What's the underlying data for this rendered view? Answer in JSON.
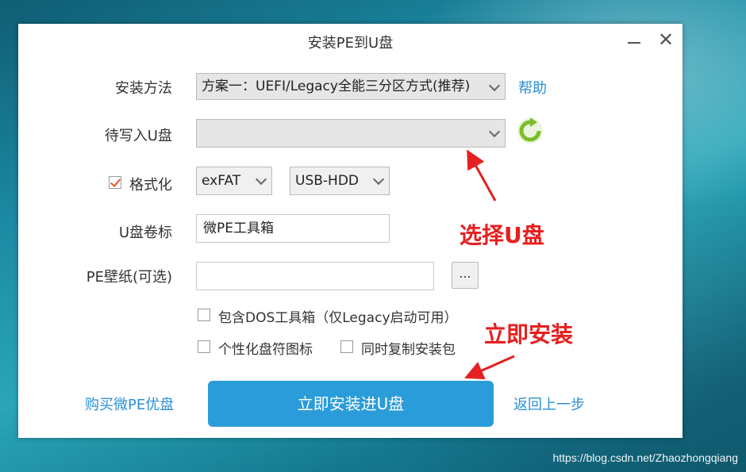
{
  "window": {
    "title": "安装PE到U盘"
  },
  "form": {
    "method_label": "安装方法",
    "method_value": "方案一：UEFI/Legacy全能三分区方式(推荐)",
    "help_link": "帮助",
    "target_label": "待写入U盘",
    "target_value": "",
    "format_label": "格式化",
    "format_checked": true,
    "fs_value": "exFAT",
    "mode_value": "USB-HDD",
    "volume_label": "U盘卷标",
    "volume_value": "微PE工具箱",
    "wallpaper_label": "PE壁纸(可选)",
    "wallpaper_value": "",
    "browse_label": "...",
    "opt_dos": "包含DOS工具箱（仅Legacy启动可用）",
    "opt_icon": "个性化盘符图标",
    "opt_copy": "同时复制安装包"
  },
  "footer": {
    "buy_link": "购买微PE优盘",
    "install_button": "立即安装进U盘",
    "back_link": "返回上一步"
  },
  "annotations": {
    "select_usb": "选择U盘",
    "install_now": "立即安装"
  },
  "watermark": "https://blog.csdn.net/Zhaozhongqiang",
  "icons": {
    "refresh": "refresh-icon",
    "close": "close-icon",
    "minimize": "minimize-icon"
  },
  "colors": {
    "accent": "#2a9cd9",
    "link": "#2b8fd6",
    "annotation": "#e52020",
    "refresh": "#7cbd2a"
  }
}
